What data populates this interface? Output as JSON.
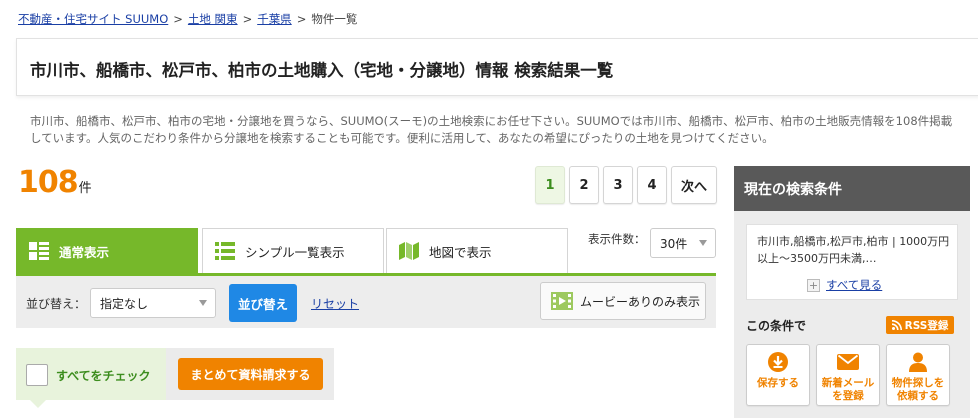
{
  "breadcrumb": {
    "items": [
      "不動産・住宅サイト SUUMO",
      "土地 関東",
      "千葉県"
    ],
    "current": "物件一覧",
    "separator": ">"
  },
  "title": "市川市、船橋市、松戸市、柏市の土地購入（宅地・分譲地）情報 検索結果一覧",
  "description": "市川市、船橋市、松戸市、柏市の宅地・分譲地を買うなら、SUUMO(スーモ)の土地検索にお任せ下さい。SUUMOでは市川市、船橋市、松戸市、柏市の土地販売情報を108件掲載しています。人気のこだわり条件から分譲地を検索することも可能です。便利に活用して、あなたの希望にぴったりの土地を見つけてください。",
  "result": {
    "count": "108",
    "unit": "件"
  },
  "pager": {
    "pages": [
      "1",
      "2",
      "3",
      "4"
    ],
    "current": "1",
    "next_label": "次へ"
  },
  "tabs": [
    {
      "label": "通常表示",
      "icon": "grid-icon",
      "active": true
    },
    {
      "label": "シンプル一覧表示",
      "icon": "list-icon",
      "active": false
    },
    {
      "label": "地図で表示",
      "icon": "map-icon",
      "active": false
    }
  ],
  "per_page": {
    "label": "表示件数：",
    "value": "30件"
  },
  "sort": {
    "label": "並び替え：",
    "value": "指定なし",
    "button_label": "並び替え",
    "reset_label": "リセット",
    "movie_label": "ムービーありのみ表示",
    "movie_icon": "movie-icon"
  },
  "bulk": {
    "check_all_label": "すべてをチェック",
    "request_label": "まとめて資料請求する"
  },
  "side_panel": {
    "title": "現在の検索条件",
    "conditions": "市川市,船橋市,松戸市,柏市 | 1000万円以上～3500万円未満,…",
    "see_all_label": "すべて見る",
    "with_conditions_label": "この条件で",
    "rss_label": "RSS登録",
    "actions": [
      {
        "label": "保存する",
        "icon": "download-icon"
      },
      {
        "label": "新着メール\nを登録",
        "icon": "mail-icon"
      },
      {
        "label": "物件探しを\n依頼する",
        "icon": "person-icon"
      }
    ]
  },
  "colors": {
    "accent_green": "#76b82a",
    "accent_orange": "#f08300",
    "link_blue": "#1a3fa5",
    "button_blue": "#1f88e5"
  }
}
